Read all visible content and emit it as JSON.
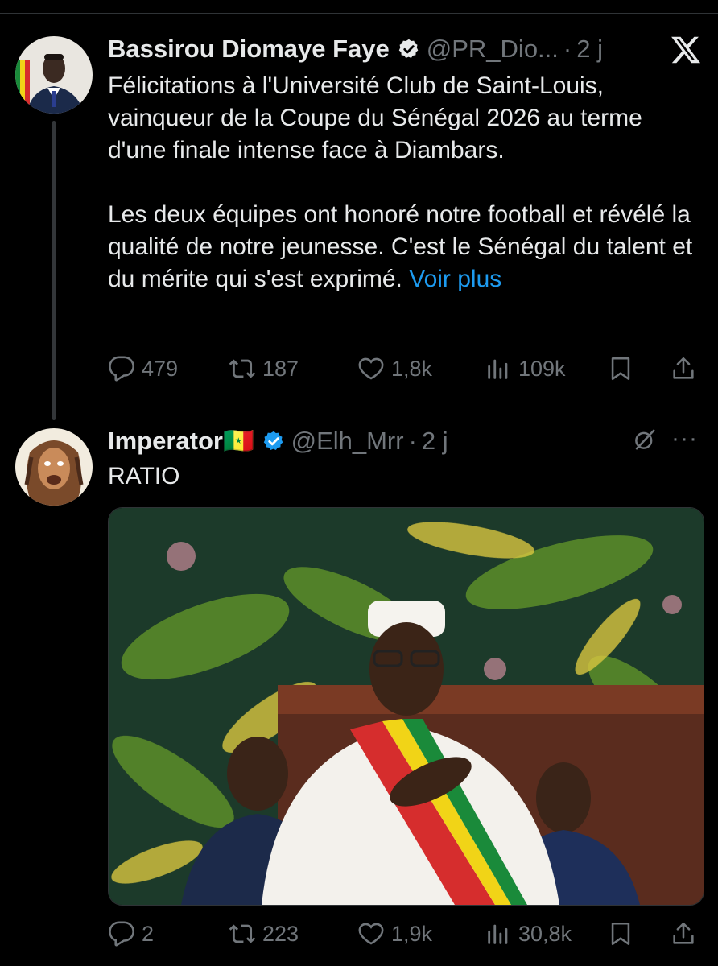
{
  "tweet1": {
    "name": "Bassirou Diomaye Faye",
    "handle": "@PR_Dio...",
    "time": "2 j",
    "text": [
      "Félicitations à l'Université Club de Saint-Louis, vainqueur de la Coupe du Sénégal 2026 au terme d'une finale intense face à Diambars.",
      "Les deux équipes ont honoré notre football et révélé la qualité de notre jeunesse. C'est le Sénégal du talent et du mérite qui s'est exprimé."
    ],
    "more_link": "Voir plus",
    "replies": "479",
    "reposts": "187",
    "likes": "1,8k",
    "views": "109k"
  },
  "tweet2": {
    "name": "Imperator🇸🇳",
    "handle": "@Elh_Mrr",
    "time": "2 j",
    "text": "RATIO",
    "replies": "2",
    "reposts": "223",
    "likes": "1,9k",
    "views": "30,8k"
  },
  "icons": {
    "close": "x-logo-icon",
    "verified": "verified-badge-icon",
    "reply": "reply-icon",
    "repost": "repost-icon",
    "like": "heart-icon",
    "views": "views-icon",
    "bookmark": "bookmark-icon",
    "share": "share-icon",
    "grok": "grok-icon",
    "more": "more-icon"
  },
  "colors": {
    "background": "#000000",
    "text": "#e7e9ea",
    "muted": "#71767b",
    "link": "#1d9bf0",
    "verified": "#1d9bf0"
  }
}
